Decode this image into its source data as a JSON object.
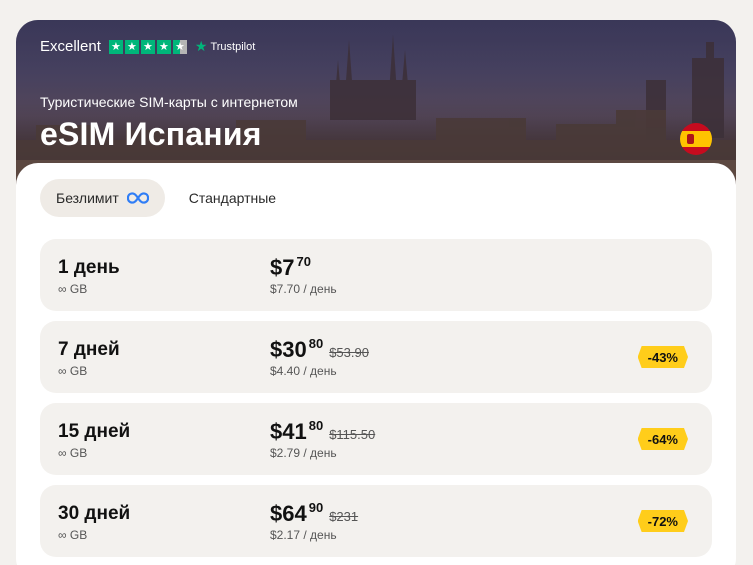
{
  "trustpilot": {
    "rating_label": "Excellent",
    "brand": "Trustpilot",
    "stars": 4.5
  },
  "header": {
    "subtitle": "Туристические SIM-карты с интернетом",
    "title": "eSIM Испания",
    "flag": "spain-flag-icon"
  },
  "tabs": [
    {
      "label": "Безлимит",
      "active": true,
      "icon": "infinity-icon"
    },
    {
      "label": "Стандартные",
      "active": false
    }
  ],
  "plans": [
    {
      "days": "1 день",
      "data": "∞ GB",
      "dollars": "$7",
      "cents": "70",
      "old_price": "",
      "per_day": "$7.70 / день",
      "discount": ""
    },
    {
      "days": "7 дней",
      "data": "∞ GB",
      "dollars": "$30",
      "cents": "80",
      "old_price": "$53.90",
      "per_day": "$4.40 / день",
      "discount": "-43%"
    },
    {
      "days": "15 дней",
      "data": "∞ GB",
      "dollars": "$41",
      "cents": "80",
      "old_price": "$115.50",
      "per_day": "$2.79 / день",
      "discount": "-64%"
    },
    {
      "days": "30 дней",
      "data": "∞ GB",
      "dollars": "$64",
      "cents": "90",
      "old_price": "$231",
      "per_day": "$2.17 / день",
      "discount": "-72%"
    }
  ],
  "colors": {
    "trustpilot_green": "#00b67a",
    "badge_yellow": "#ffcd1a",
    "infinity_blue": "#2f7df6",
    "plan_background": "#f3f1ee"
  }
}
